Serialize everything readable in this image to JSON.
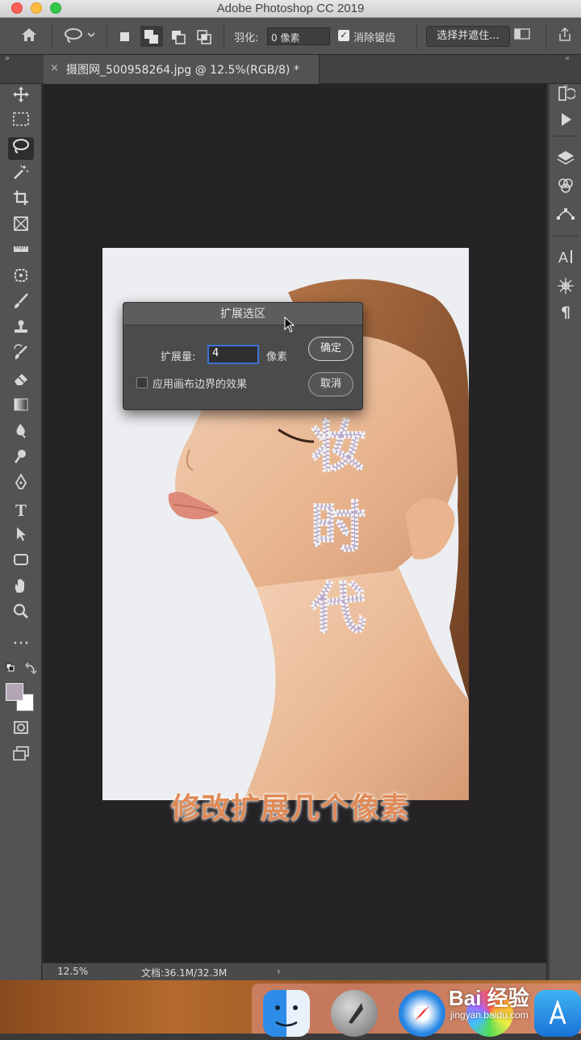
{
  "app": {
    "title": "Adobe Photoshop CC 2019"
  },
  "options_bar": {
    "feather_label": "羽化:",
    "feather_value": "0 像素",
    "antialias_label": "消除锯齿",
    "select_mask_button": "选择并遮住..."
  },
  "document_tab": {
    "label": "摄图网_500958264.jpg @ 12.5%(RGB/8) *",
    "close_glyph": "×"
  },
  "canvas_text": {
    "selected_text": [
      "妆",
      "时",
      "代"
    ]
  },
  "dialog": {
    "title": "扩展选区",
    "expand_label": "扩展量:",
    "expand_value": "4",
    "unit": "像素",
    "ok_button": "确定",
    "cancel_button": "取消",
    "canvas_bounds_label": "应用画布边界的效果"
  },
  "caption": "修改扩展几个像素",
  "status_bar": {
    "zoom": "12.5%",
    "doc_info": "文档:36.1M/32.3M",
    "arrow": "›"
  },
  "watermark": {
    "text": "Bai 经验",
    "url": "jingyan.baidu.com"
  },
  "colors": {
    "foreground": "#b3a4b6",
    "background": "#ffffff",
    "caption": "#e08a57",
    "focus": "#3c73d6"
  }
}
